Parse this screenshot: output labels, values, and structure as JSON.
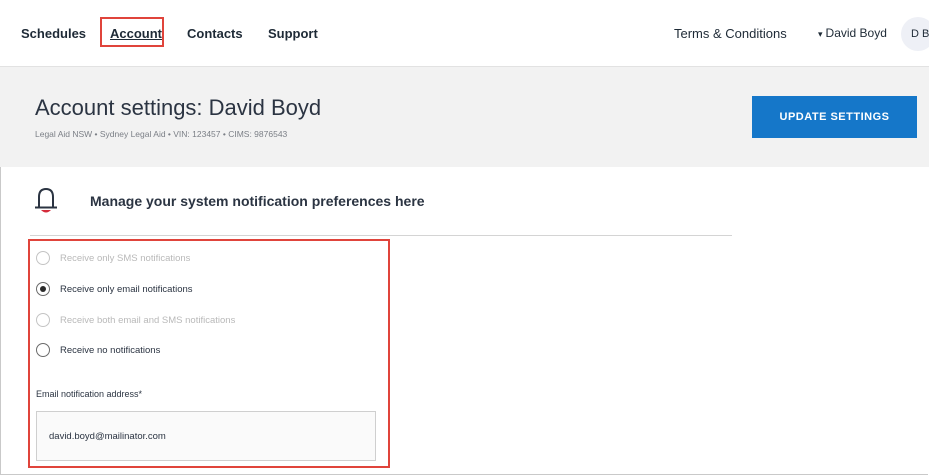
{
  "nav": {
    "items": [
      {
        "label": "Schedules"
      },
      {
        "label": "Account"
      },
      {
        "label": "Contacts"
      },
      {
        "label": "Support"
      }
    ],
    "terms": "Terms & Conditions",
    "user_name": "David Boyd",
    "user_initials": "D B"
  },
  "header": {
    "title": "Account settings: David Boyd",
    "subtitle": "Legal Aid NSW • Sydney Legal Aid • VIN: 123457 • CIMS: 9876543",
    "update_button": "UPDATE SETTINGS"
  },
  "notifications": {
    "heading": "Manage your system notification preferences here",
    "options": [
      {
        "label": "Receive only SMS notifications",
        "state": "disabled"
      },
      {
        "label": "Receive only email notifications",
        "state": "selected"
      },
      {
        "label": "Receive both email and SMS notifications",
        "state": "disabled"
      },
      {
        "label": "Receive no notifications",
        "state": "enabled"
      }
    ],
    "email_label": "Email notification address*",
    "email_value": "david.boyd@mailinator.com"
  },
  "colors": {
    "accent_blue": "#1577c9",
    "highlight_red": "#e0443b",
    "bell_red": "#d42b3a",
    "text_dark": "#2b3442"
  },
  "icons": {
    "bell": "bell-icon",
    "user_menu": "chevron-down-icon"
  }
}
